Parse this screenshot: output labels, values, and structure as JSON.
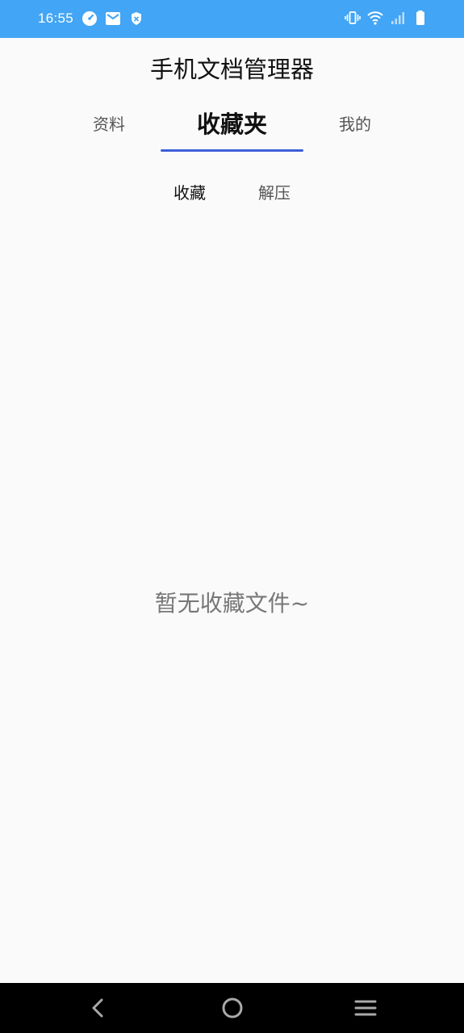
{
  "status_bar": {
    "time": "16:55",
    "left_icons": [
      "speedometer-icon",
      "mail-icon",
      "shield-icon"
    ],
    "right_icons": [
      "vibrate-icon",
      "wifi-icon",
      "signal-icon",
      "battery-icon"
    ],
    "background": "#42a5f5"
  },
  "app": {
    "title": "手机文档管理器"
  },
  "main_tabs": [
    {
      "label": "资料",
      "active": false
    },
    {
      "label": "收藏夹",
      "active": true
    },
    {
      "label": "我的",
      "active": false
    }
  ],
  "sub_tabs": [
    {
      "label": "收藏",
      "active": true
    },
    {
      "label": "解压",
      "active": false
    }
  ],
  "empty_state": {
    "message": "暂无收藏文件~"
  },
  "nav_bar": {
    "buttons": [
      "back-icon",
      "home-icon",
      "menu-icon"
    ]
  },
  "colors": {
    "accent": "#3e5fd8",
    "status_bar": "#42a5f5",
    "background": "#fafafa"
  }
}
